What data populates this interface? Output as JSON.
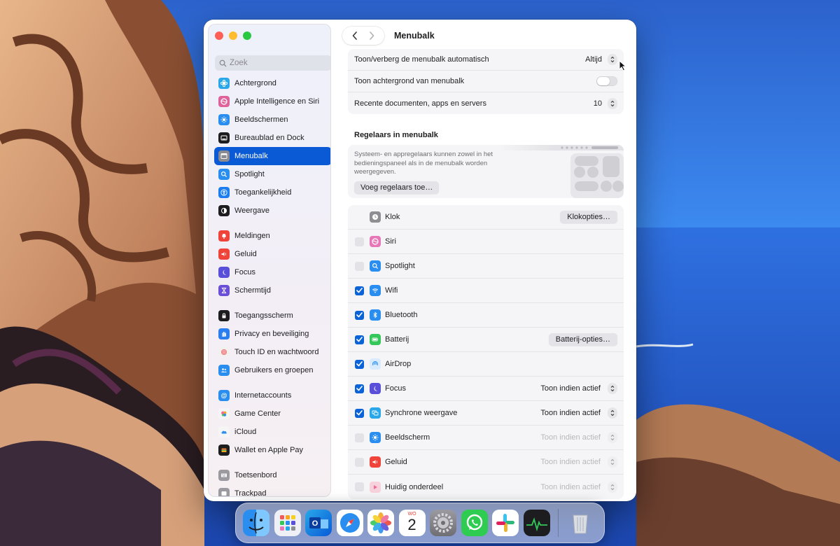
{
  "window": {
    "title": "Menubalk"
  },
  "sidebar": {
    "search_placeholder": "Zoek",
    "groups": [
      [
        {
          "label": "Achtergrond",
          "icon": "flower-icon",
          "color": "#2aa7e8"
        },
        {
          "label": "Apple Intelligence en Siri",
          "icon": "siri-icon",
          "color": "#e0629a"
        },
        {
          "label": "Beeldschermen",
          "icon": "sun-icon",
          "color": "#2a8ef0"
        },
        {
          "label": "Bureaublad en Dock",
          "icon": "dock-icon",
          "color": "#1d1d1f"
        },
        {
          "label": "Menubalk",
          "icon": "menubar-icon",
          "color": "#8a8a90",
          "active": true
        },
        {
          "label": "Spotlight",
          "icon": "magnifier-icon",
          "color": "#2a8ef0"
        },
        {
          "label": "Toegankelijkheid",
          "icon": "accessibility-icon",
          "color": "#1a7ef2"
        },
        {
          "label": "Weergave",
          "icon": "appearance-icon",
          "color": "#1d1d1f"
        }
      ],
      [
        {
          "label": "Meldingen",
          "icon": "bell-icon",
          "color": "#f0443a"
        },
        {
          "label": "Geluid",
          "icon": "speaker-icon",
          "color": "#f0443a"
        },
        {
          "label": "Focus",
          "icon": "moon-icon",
          "color": "#5a4fd8"
        },
        {
          "label": "Schermtijd",
          "icon": "hourglass-icon",
          "color": "#6a4fd8"
        }
      ],
      [
        {
          "label": "Toegangsscherm",
          "icon": "lock-icon",
          "color": "#1d1d1f"
        },
        {
          "label": "Privacy en beveiliging",
          "icon": "hand-icon",
          "color": "#2a7ef0"
        },
        {
          "label": "Touch ID en wachtwoord",
          "icon": "fingerprint-icon",
          "color": "#f3f0f0"
        },
        {
          "label": "Gebruikers en groepen",
          "icon": "users-icon",
          "color": "#2a8ef0"
        }
      ],
      [
        {
          "label": "Internetaccounts",
          "icon": "at-icon",
          "color": "#2a8ef0"
        },
        {
          "label": "Game Center",
          "icon": "gamecenter-icon",
          "color": "#f5f5f5"
        },
        {
          "label": "iCloud",
          "icon": "cloud-icon",
          "color": "#f5f5f5"
        },
        {
          "label": "Wallet en Apple Pay",
          "icon": "wallet-icon",
          "color": "#1d1d1f"
        }
      ],
      [
        {
          "label": "Toetsenbord",
          "icon": "keyboard-icon",
          "color": "#9a9aa0"
        },
        {
          "label": "Trackpad",
          "icon": "trackpad-icon",
          "color": "#9a9aa0"
        }
      ]
    ]
  },
  "settings": {
    "autohide_label": "Toon/verberg de menubalk automatisch",
    "autohide_value": "Altijd",
    "background_label": "Toon achtergrond van menubalk",
    "background_on": false,
    "recent_label": "Recente documenten, apps en servers",
    "recent_value": "10"
  },
  "controls_section": {
    "title": "Regelaars in menubalk",
    "info": "Systeem- en appregelaars kunnen zowel in het bedieningspaneel als in de menubalk worden weergegeven.",
    "add_button": "Voeg regelaars toe…"
  },
  "controls": [
    {
      "name": "Klok",
      "checked": null,
      "icon": "clock-icon",
      "color": "#8e8e93",
      "button": "Klokopties…"
    },
    {
      "name": "Siri",
      "checked": false,
      "icon": "siri-icon",
      "color": "#e877b8"
    },
    {
      "name": "Spotlight",
      "checked": false,
      "icon": "magnifier-icon",
      "color": "#2a8ef0"
    },
    {
      "name": "Wifi",
      "checked": true,
      "icon": "wifi-icon",
      "color": "#2a8ef0"
    },
    {
      "name": "Bluetooth",
      "checked": true,
      "icon": "bluetooth-icon",
      "color": "#2a8ef0"
    },
    {
      "name": "Batterij",
      "checked": true,
      "icon": "battery-icon",
      "color": "#34c759",
      "button": "Batterij-opties…"
    },
    {
      "name": "AirDrop",
      "checked": true,
      "icon": "airdrop-icon",
      "color": "#d9ecff"
    },
    {
      "name": "Focus",
      "checked": true,
      "icon": "moon-icon",
      "color": "#5a4fd8",
      "option": "Toon indien actief",
      "dim": false
    },
    {
      "name": "Synchrone weergave",
      "checked": true,
      "icon": "mirror-icon",
      "color": "#2aa7e8",
      "option": "Toon indien actief",
      "dim": false
    },
    {
      "name": "Beeldscherm",
      "checked": false,
      "icon": "sun-icon",
      "color": "#2a8ef0",
      "option": "Toon indien actief",
      "dim": true
    },
    {
      "name": "Geluid",
      "checked": false,
      "icon": "speaker-icon",
      "color": "#f0443a",
      "option": "Toon indien actief",
      "dim": true
    },
    {
      "name": "Huidig onderdeel",
      "checked": false,
      "icon": "play-icon",
      "color": "#f7d2dc",
      "option": "Toon indien actief",
      "dim": true
    }
  ],
  "dock": {
    "apps": [
      "finder-icon",
      "launchpad-icon",
      "outlook-icon",
      "safari-icon",
      "photos-icon",
      "calendar-icon",
      "system-settings-icon",
      "whatsapp-icon",
      "slack-icon",
      "activity-monitor-icon"
    ],
    "calendar_month": "WO",
    "calendar_day": "2",
    "trash": "trash-icon"
  }
}
